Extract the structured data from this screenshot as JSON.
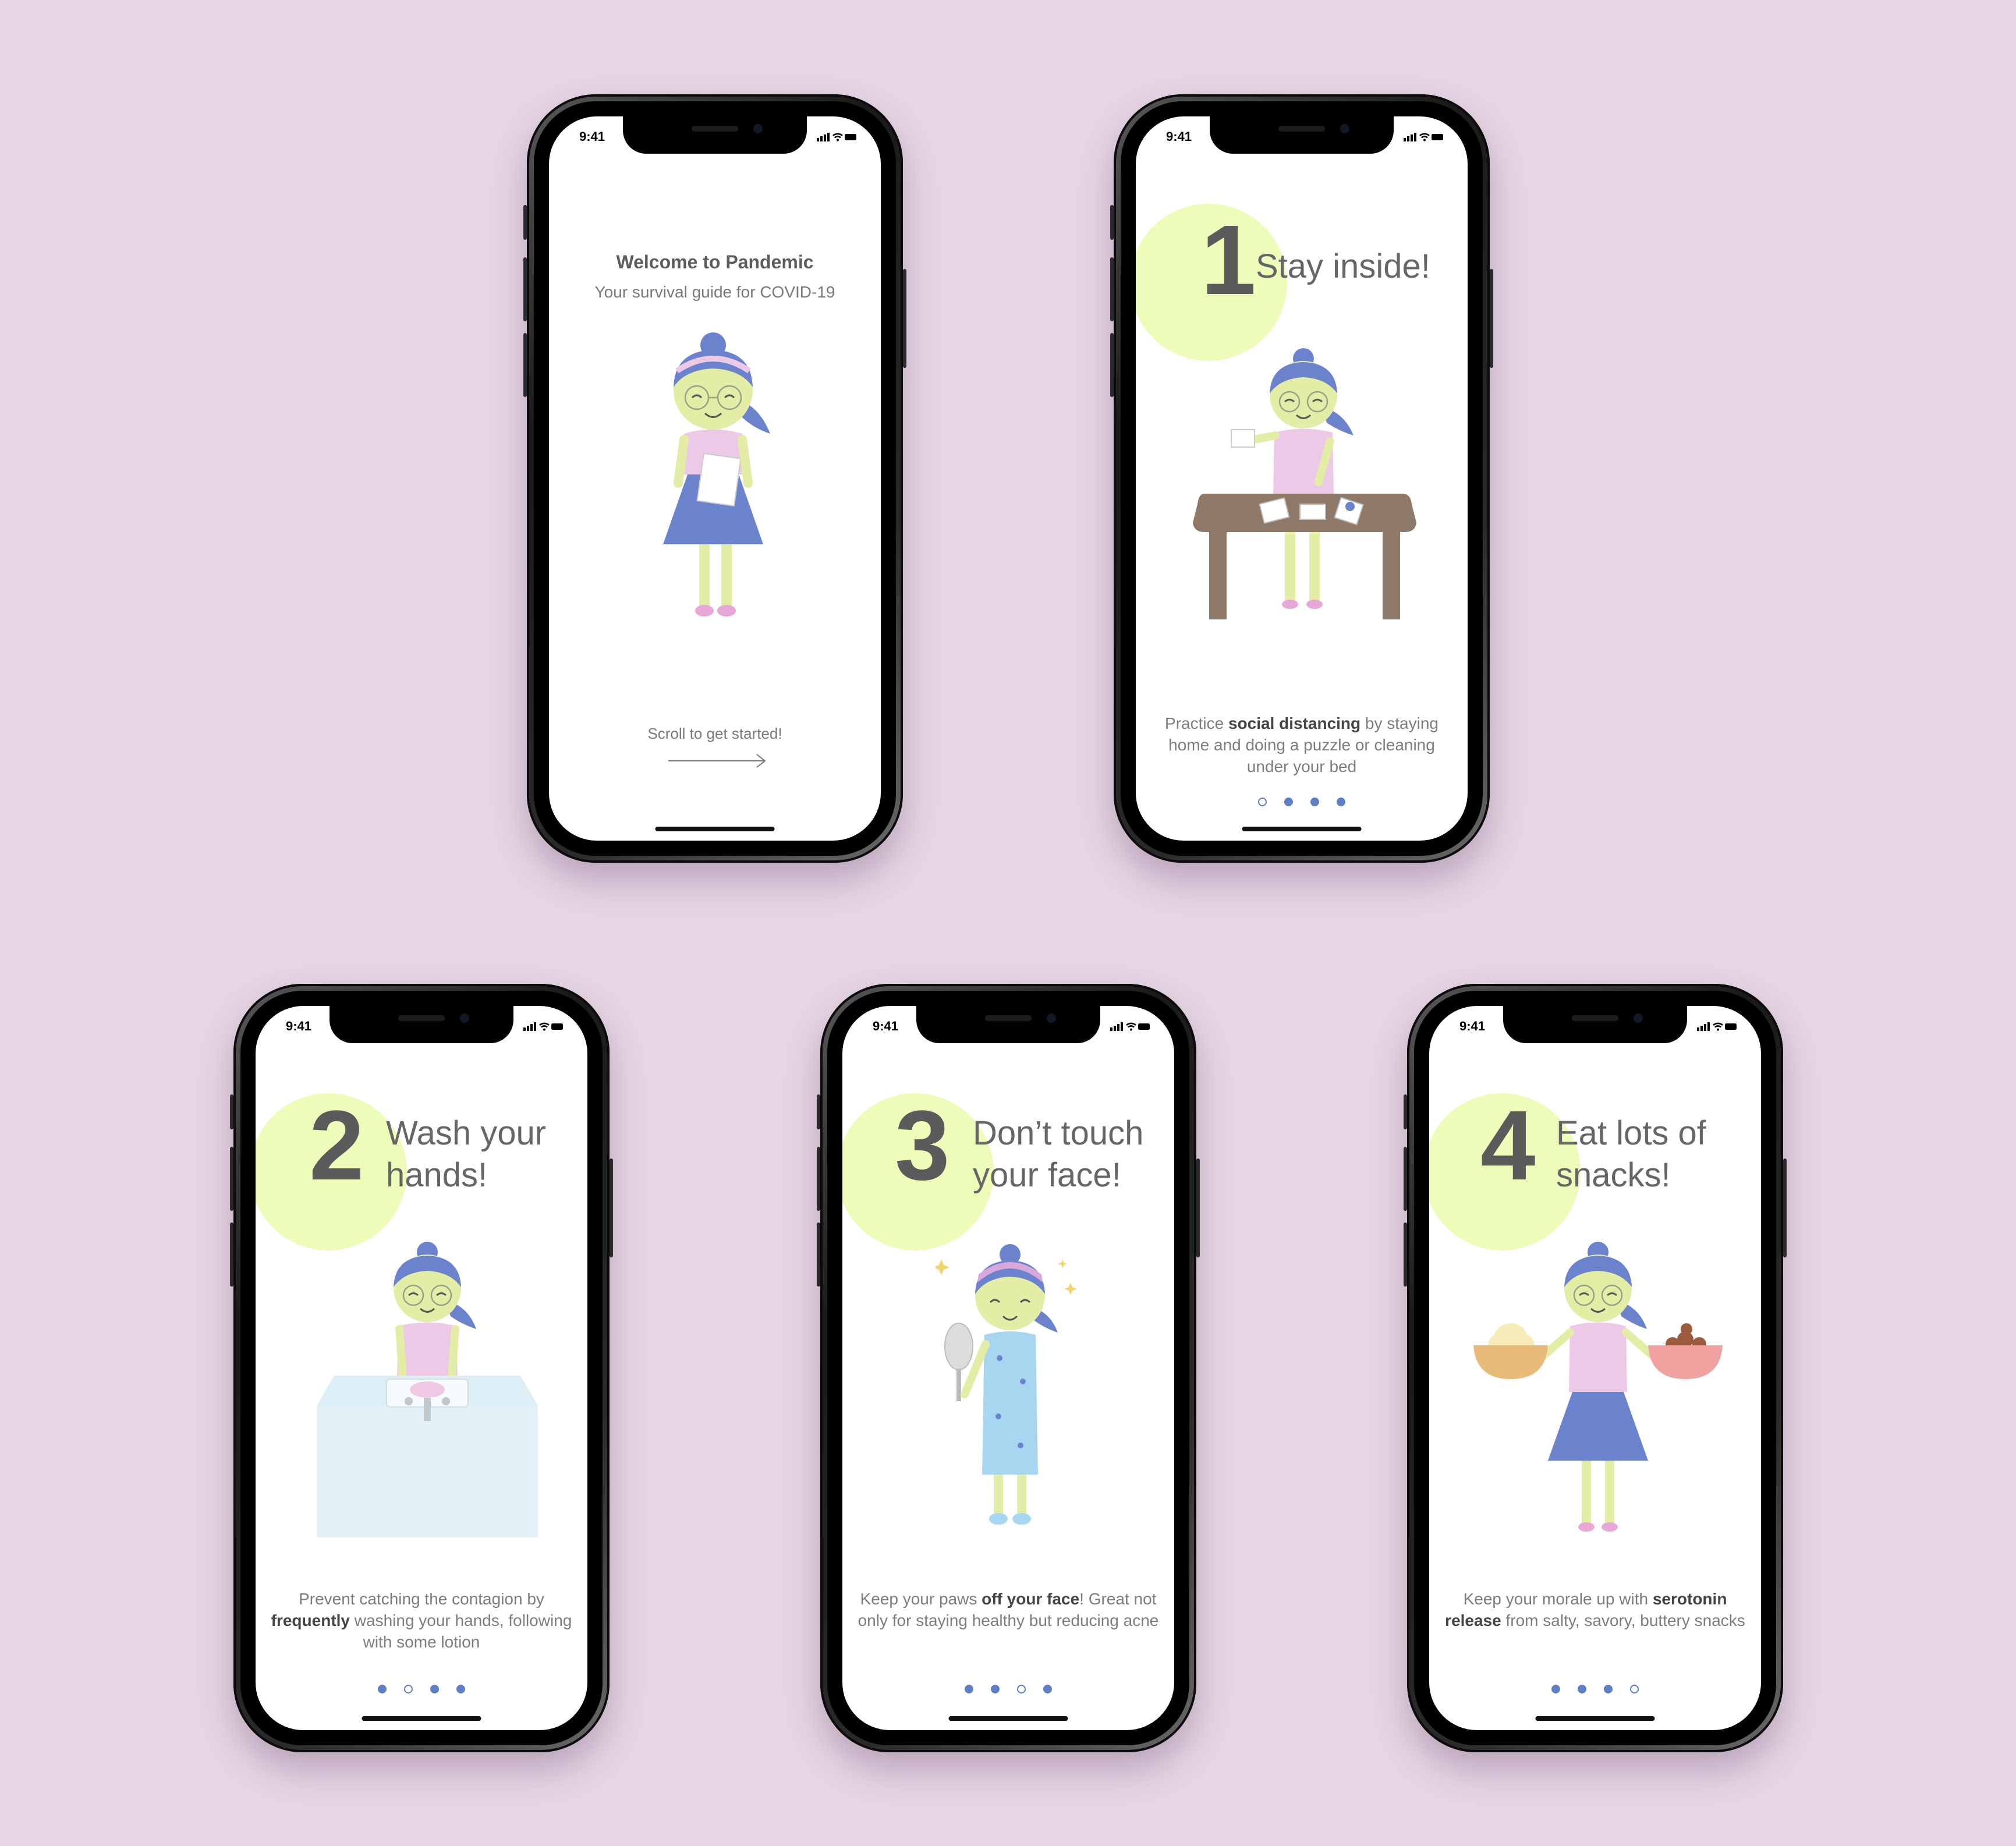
{
  "status_time": "9:41",
  "welcome": {
    "title": "Welcome to Pandemic",
    "subtitle": "Your survival guide for COVID-19",
    "cta": "Scroll to get started!"
  },
  "steps": [
    {
      "number": "1",
      "title_line1": "Stay inside!",
      "title_line2": "",
      "caption": {
        "pre": "Practice ",
        "bold": "social distancing",
        "post": " by staying home and doing a puzzle or cleaning under your bed"
      },
      "dots": [
        false,
        true,
        true,
        true
      ]
    },
    {
      "number": "2",
      "title_line1": "Wash your",
      "title_line2": "hands!",
      "caption": {
        "pre": "Prevent catching the contagion by ",
        "bold": "frequently",
        "post": " washing your hands, following with some lotion"
      },
      "dots": [
        true,
        false,
        true,
        true
      ]
    },
    {
      "number": "3",
      "title_line1": "Don’t touch",
      "title_line2": "your face!",
      "caption": {
        "pre": "Keep your paws ",
        "bold": "off your face",
        "post": "! Great not only for staying healthy but reducing acne"
      },
      "dots": [
        true,
        true,
        false,
        true
      ]
    },
    {
      "number": "4",
      "title_line1": "Eat lots of",
      "title_line2": "snacks!",
      "caption": {
        "pre": "Keep your morale up with ",
        "bold": "serotonin release",
        "post": " from salty, savory, buttery snacks"
      },
      "dots": [
        true,
        true,
        true,
        false
      ]
    }
  ],
  "colors": {
    "background": "#e6d5e5",
    "number_blob": "#eefcb9",
    "accent_blue": "#5d7fc4",
    "hair": "#6b83cc",
    "skin": "#e4eda5",
    "shirt": "#ecc9e6"
  }
}
